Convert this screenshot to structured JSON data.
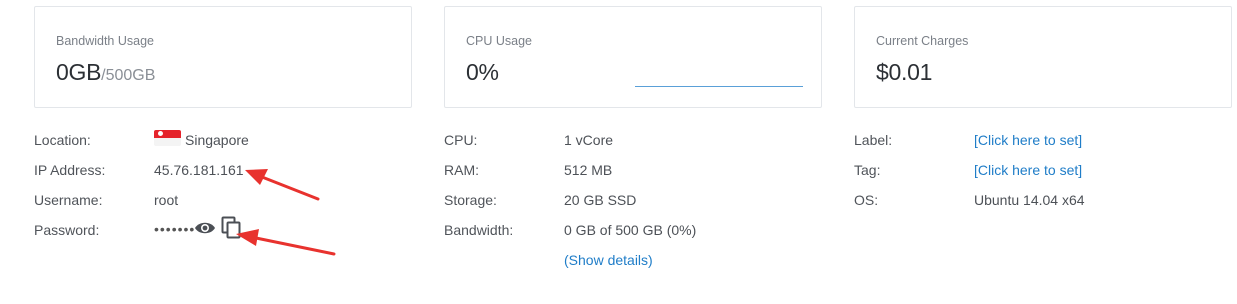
{
  "cards": {
    "bandwidth": {
      "title": "Bandwidth Usage",
      "value": "0GB",
      "suffix": "/500GB"
    },
    "cpu": {
      "title": "CPU Usage",
      "value": "0%"
    },
    "charges": {
      "title": "Current Charges",
      "value": "$0.01"
    }
  },
  "server": {
    "location_label": "Location:",
    "location_value": "Singapore",
    "ip_label": "IP Address:",
    "ip_value": "45.76.181.161",
    "username_label": "Username:",
    "username_value": "root",
    "password_label": "Password:",
    "password_mask": "•••••••",
    "flag_icon": "singapore-flag-icon",
    "eye_icon": "eye-icon",
    "copy_icon": "copy-icon"
  },
  "specs": {
    "cpu_label": "CPU:",
    "cpu_value": "1 vCore",
    "ram_label": "RAM:",
    "ram_value": "512 MB",
    "storage_label": "Storage:",
    "storage_value": "20 GB SSD",
    "bandwidth_label": "Bandwidth:",
    "bandwidth_value": "0 GB of 500 GB (0%)",
    "show_details": "(Show details)"
  },
  "meta": {
    "label_label": "Label:",
    "label_value": "[Click here to set]",
    "tag_label": "Tag:",
    "tag_value": "[Click here to set]",
    "os_label": "OS:",
    "os_value": "Ubuntu 14.04 x64"
  },
  "colors": {
    "link": "#1f7dc8",
    "arrow": "#e8322e",
    "graph_line": "#5aa0d8"
  }
}
